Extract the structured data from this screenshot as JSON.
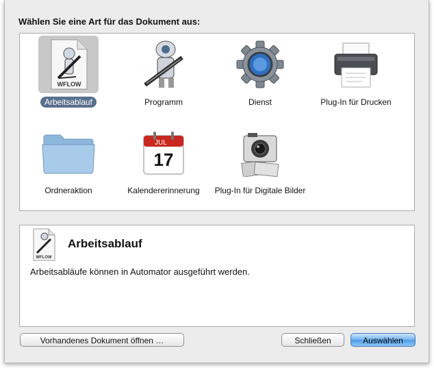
{
  "dialog": {
    "prompt": "Wählen Sie eine Art für das Dokument aus:"
  },
  "templates": [
    {
      "label": "Arbeitsablauf",
      "icon": "workflow-document-icon",
      "selected": true
    },
    {
      "label": "Programm",
      "icon": "automator-robot-icon",
      "selected": false
    },
    {
      "label": "Dienst",
      "icon": "gear-icon",
      "selected": false
    },
    {
      "label": "Plug-In für Drucken",
      "icon": "printer-icon",
      "selected": false
    },
    {
      "label": "Ordneraktion",
      "icon": "folder-icon",
      "selected": false
    },
    {
      "label": "Kalendererinnerung",
      "icon": "calendar-icon",
      "selected": false
    },
    {
      "label": "Plug-In für Digitale Bilder",
      "icon": "camera-icon",
      "selected": false
    }
  ],
  "calendar_icon": {
    "month": "JUL",
    "day": "17"
  },
  "workflow_icon": {
    "badge": "WFLOW"
  },
  "description": {
    "title": "Arbeitsablauf",
    "text": "Arbeitsabläufe können in Automator ausgeführt werden."
  },
  "buttons": {
    "open_existing": "Vorhandenes Dokument öffnen …",
    "close": "Schließen",
    "choose": "Auswählen"
  },
  "colors": {
    "selection_label": "#5a6f8e",
    "primary_button": "#4f9be6"
  }
}
